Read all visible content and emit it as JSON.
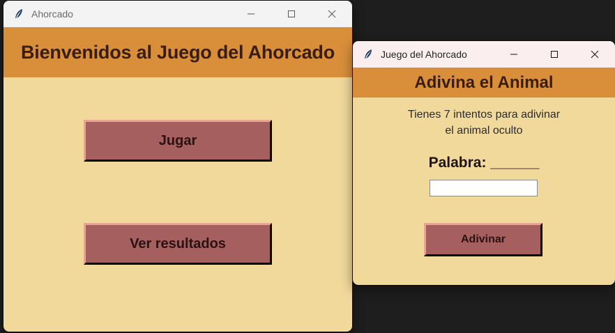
{
  "main_window": {
    "title": "Ahorcado",
    "header": "Bienvenidos al Juego del Ahorcado",
    "buttons": {
      "play": "Jugar",
      "results": "Ver resultados"
    }
  },
  "game_window": {
    "title": "Juego del Ahorcado",
    "header": "Adivina el Animal",
    "instructions": [
      "Tienes 7 intentos para adivinar",
      "el animal oculto"
    ],
    "word_label": "Palabra: ______",
    "guess_input": {
      "value": "",
      "placeholder": ""
    },
    "guess_button": "Adivinar"
  },
  "colors": {
    "header_bg": "#d98f3a",
    "body_bg": "#f1d99c",
    "button_bg": "#a55f5f",
    "button_highlight": "#e8a494",
    "text_dark": "#3a1d12"
  },
  "icons": {
    "app": "feather-icon",
    "minimize": "minimize-icon",
    "maximize": "maximize-icon",
    "close": "close-icon"
  }
}
